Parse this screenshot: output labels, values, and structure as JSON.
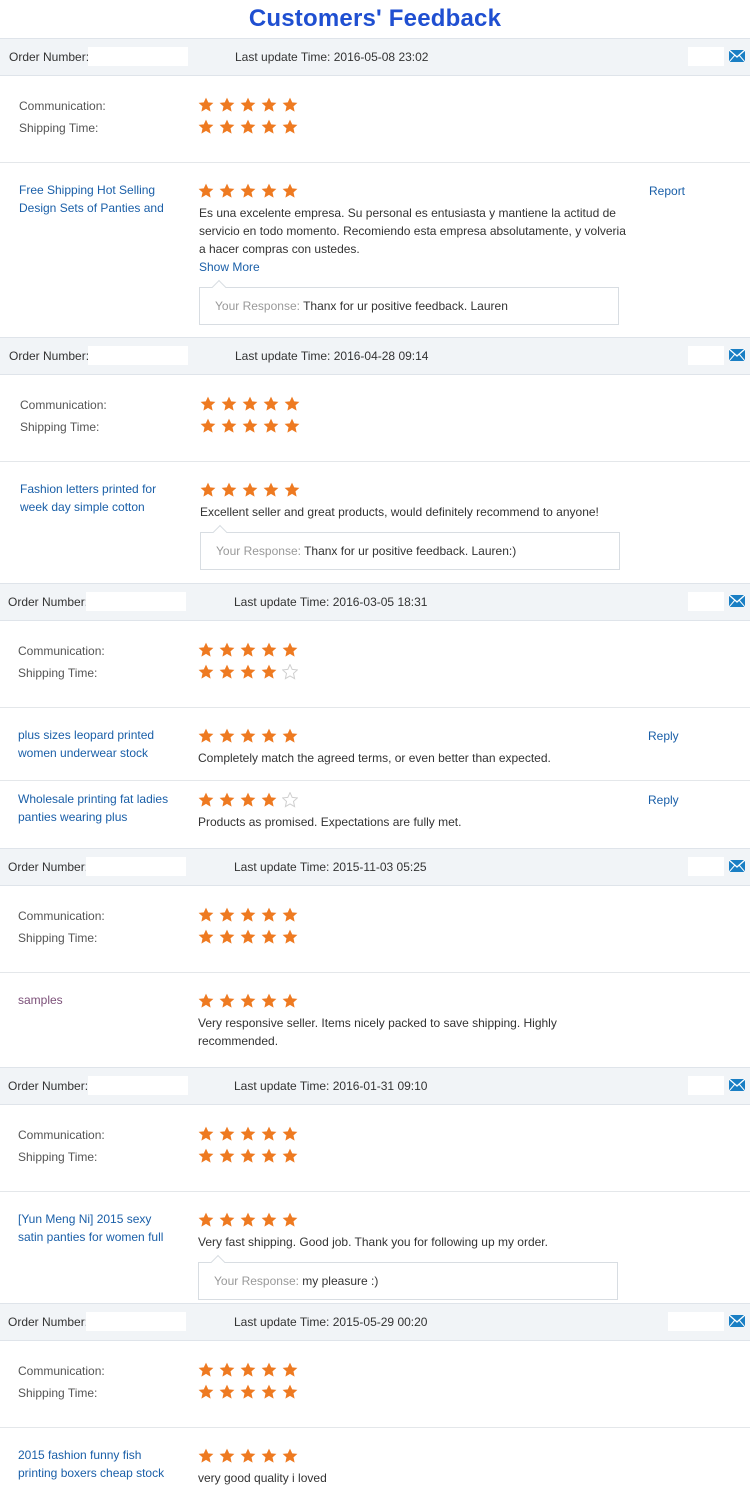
{
  "page": {
    "title": "Customers' Feedback",
    "order_number_label": "Order Number:",
    "communication_label": "Communication:",
    "shipping_label": "Shipping Time:",
    "response_label": "Your Response:",
    "show_more_label": "Show More",
    "star_color_filled": "#ee7a21",
    "star_color_empty": "#cfcfcf"
  },
  "orders": [
    {
      "update_time": "Last update Time: 2016-05-08 23:02",
      "communication_stars": 5,
      "shipping_stars": 5,
      "items": [
        {
          "name": "Free Shipping Hot Selling Design Sets of Panties and",
          "stars": 5,
          "comment": "Es una excelente empresa. Su personal es entusiasta y mantiene la actitud de servicio en todo momento. Recomiendo esta empresa absolutamente, y volveria a hacer compras con ustedes.",
          "show_more": true,
          "action": "Report",
          "response": "Thanx for ur positive feedback. Lauren"
        }
      ]
    },
    {
      "update_time": "Last update Time: 2016-04-28 09:14",
      "communication_stars": 5,
      "shipping_stars": 5,
      "items": [
        {
          "name": "Fashion letters printed for week day simple cotton",
          "stars": 5,
          "comment": "Excellent seller and great products, would definitely recommend to anyone!",
          "response": "Thanx for ur positive feedback. Lauren:)"
        }
      ]
    },
    {
      "update_time": "Last update Time: 2016-03-05 18:31",
      "communication_stars": 5,
      "shipping_stars": 4,
      "items": [
        {
          "name": "plus sizes leopard printed women underwear stock",
          "stars": 5,
          "comment": "Completely match the agreed terms, or even better than expected.",
          "action": "Reply"
        },
        {
          "name": "Wholesale printing fat ladies panties wearing plus",
          "stars": 4,
          "comment": "Products as promised. Expectations are fully met.",
          "action": "Reply"
        }
      ]
    },
    {
      "update_time": "Last update Time: 2015-11-03 05:25",
      "communication_stars": 5,
      "shipping_stars": 5,
      "items": [
        {
          "name": "samples",
          "stars": 5,
          "comment": "Very responsive seller. Items nicely packed to save shipping. Highly recommended."
        }
      ]
    },
    {
      "update_time": "Last update Time: 2016-01-31 09:10",
      "communication_stars": 5,
      "shipping_stars": 5,
      "items": [
        {
          "name": "[Yun Meng Ni] 2015 sexy satin panties for women full",
          "stars": 5,
          "comment": "Very fast shipping. Good job. Thank you for following up my order.",
          "response": "my pleasure :)"
        }
      ]
    },
    {
      "update_time": "Last update Time: 2015-05-29 00:20",
      "communication_stars": 5,
      "shipping_stars": 5,
      "items": [
        {
          "name": "2015 fashion funny fish printing boxers cheap stock",
          "stars": 5,
          "comment": "very good quality i loved"
        }
      ]
    }
  ]
}
